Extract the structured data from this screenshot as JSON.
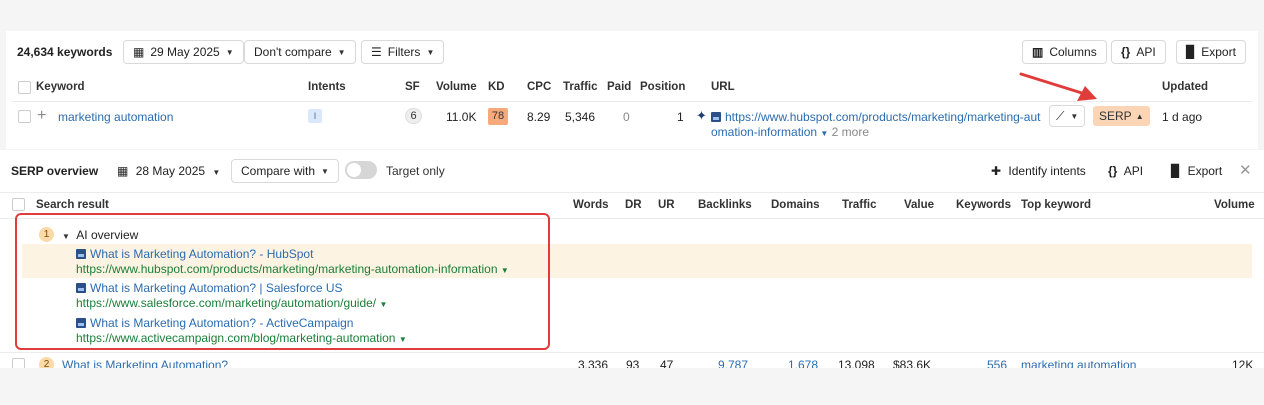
{
  "toolbar": {
    "keyword_count": "24,634 keywords",
    "date": "29 May 2025",
    "compare": "Don't compare",
    "filters": "Filters",
    "columns": "Columns",
    "api": "API",
    "export": "Export"
  },
  "table": {
    "headers": {
      "keyword": "Keyword",
      "intents": "Intents",
      "sf": "SF",
      "volume": "Volume",
      "kd": "KD",
      "cpc": "CPC",
      "traffic": "Traffic",
      "paid": "Paid",
      "position": "Position",
      "url": "URL",
      "updated": "Updated"
    },
    "row": {
      "keyword": "marketing automation",
      "intent": "I",
      "sf": "6",
      "volume": "11.0K",
      "kd": "78",
      "cpc": "8.29",
      "traffic": "5,346",
      "paid": "0",
      "position": "1",
      "url_line1": "https://www.hubspot.com/products/marketing/marketing-aut",
      "url_line2": "omation-information",
      "more": "2 more",
      "serp": "SERP",
      "updated": "1 d ago"
    }
  },
  "serp": {
    "title": "SERP overview",
    "date": "28 May 2025",
    "compare": "Compare with",
    "target_only": "Target only",
    "identify": "Identify intents",
    "api": "API",
    "export": "Export",
    "headers": {
      "search_result": "Search result",
      "words": "Words",
      "dr": "DR",
      "ur": "UR",
      "backlinks": "Backlinks",
      "domains": "Domains",
      "traffic": "Traffic",
      "value": "Value",
      "keywords": "Keywords",
      "top_keyword": "Top keyword",
      "volume": "Volume"
    },
    "ai_overview": {
      "position": "1",
      "label": "AI overview",
      "results": [
        {
          "title": "What is Marketing Automation? - HubSpot",
          "url": "https://www.hubspot.com/products/marketing/marketing-automation-information"
        },
        {
          "title": "What is Marketing Automation? | Salesforce US",
          "url": "https://www.salesforce.com/marketing/automation/guide/"
        },
        {
          "title": "What is Marketing Automation? - ActiveCampaign",
          "url": "https://www.activecampaign.com/blog/marketing-automation"
        }
      ]
    },
    "row2": {
      "position": "2",
      "title": "What is Marketing Automation?",
      "words": "3,336",
      "dr": "93",
      "ur": "47",
      "backlinks": "9,787",
      "domains": "1,678",
      "traffic": "13,098",
      "value": "$83.6K",
      "keywords": "556",
      "top_keyword": "marketing automation",
      "volume": "12K"
    }
  }
}
